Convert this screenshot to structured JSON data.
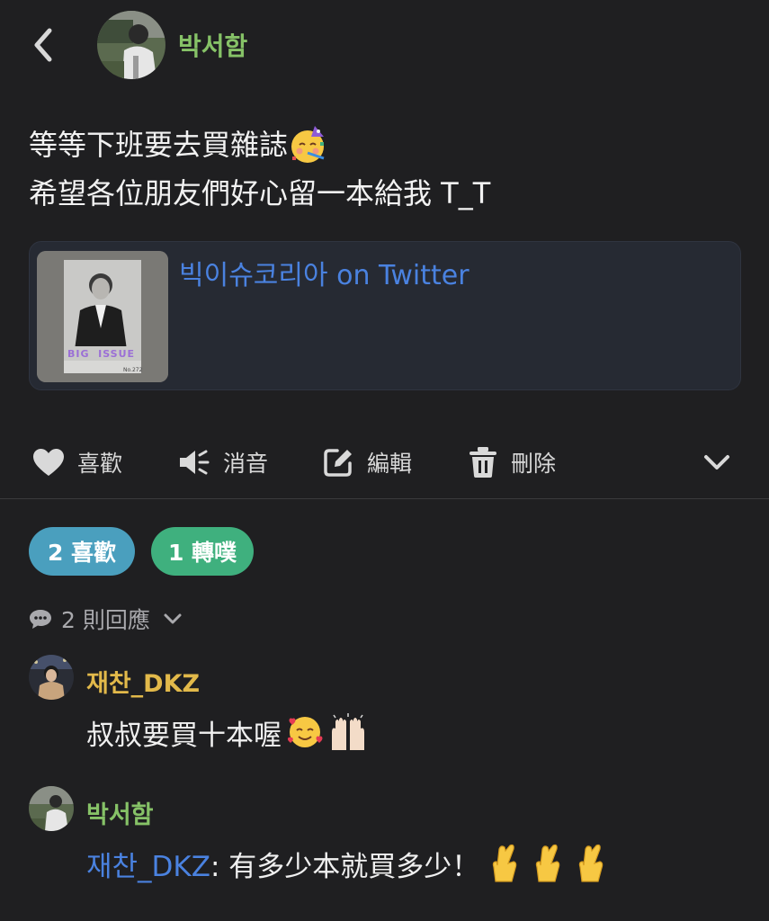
{
  "header": {
    "author_name": "박서함",
    "author_color": "#86c267"
  },
  "post": {
    "line1": "等等下班要去買雜誌",
    "line2": "希望各位朋友們好心留一本給我 T_T",
    "emoji_line1": "partying-face-emoji"
  },
  "link_card": {
    "title": "빅이슈코리아 on Twitter",
    "thumb": {
      "masthead": "BIG  ISSUE",
      "issue_no": "No.272"
    }
  },
  "actions": {
    "like": "喜歡",
    "mute": "消音",
    "edit": "編輯",
    "delete": "刪除"
  },
  "stats": {
    "likes": "2 喜歡",
    "reblogs": "1 轉噗"
  },
  "replies": {
    "label": "2 則回應"
  },
  "comments": [
    {
      "name": "재찬_DKZ",
      "name_color": "#e2b94a",
      "text": "叔叔要買十本喔",
      "emojis": [
        "smiling-face-with-hearts-emoji",
        "raising-hands-emoji"
      ]
    },
    {
      "name": "박서함",
      "name_color": "#86c267",
      "mention": "재찬_DKZ",
      "text": ": 有多少本就買多少！",
      "emojis": [
        "crossed-fingers-emoji",
        "crossed-fingers-emoji",
        "crossed-fingers-emoji"
      ]
    }
  ],
  "colors": {
    "background": "#1f1f21",
    "link": "#4a82e0",
    "likes_pill": "#4a9fbe",
    "reblogs_pill": "#3fb07e"
  }
}
